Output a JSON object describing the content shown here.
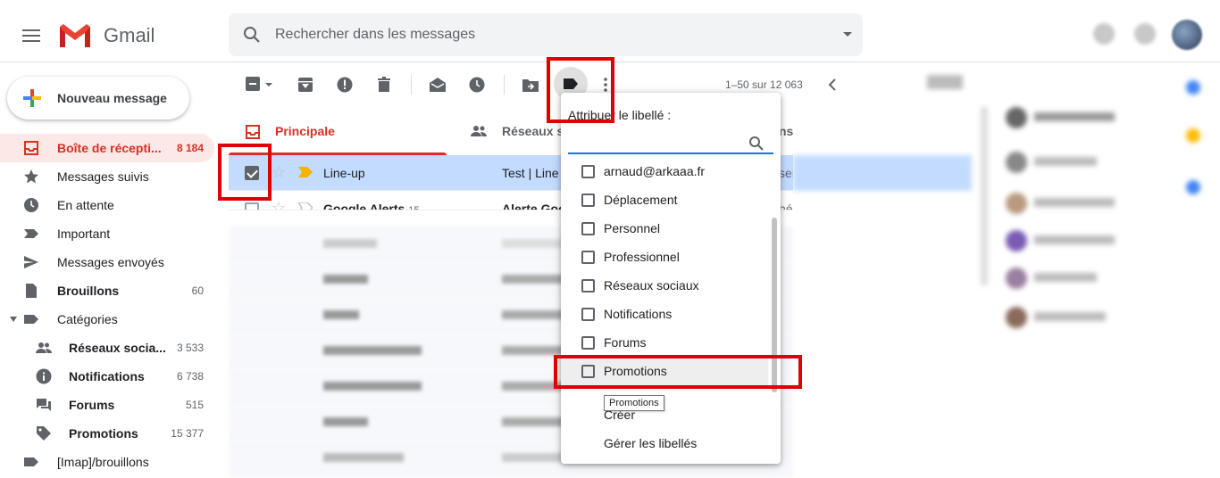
{
  "header": {
    "app_name": "Gmail",
    "search_placeholder": "Rechercher dans les messages"
  },
  "sidebar": {
    "compose_label": "Nouveau message",
    "items": [
      {
        "label": "Boîte de récepti...",
        "count": "8 184",
        "icon": "inbox-icon"
      },
      {
        "label": "Messages suivis",
        "count": "",
        "icon": "star-icon"
      },
      {
        "label": "En attente",
        "count": "",
        "icon": "clock-icon"
      },
      {
        "label": "Important",
        "count": "",
        "icon": "important-icon"
      },
      {
        "label": "Messages envoyés",
        "count": "",
        "icon": "send-icon"
      },
      {
        "label": "Brouillons",
        "count": "60",
        "icon": "draft-icon"
      },
      {
        "label": "Catégories",
        "count": "",
        "icon": "label-icon"
      },
      {
        "label": "Réseaux socia...",
        "count": "3 533",
        "icon": "people-icon"
      },
      {
        "label": "Notifications",
        "count": "6 738",
        "icon": "info-icon"
      },
      {
        "label": "Forums",
        "count": "515",
        "icon": "forum-icon"
      },
      {
        "label": "Promotions",
        "count": "15 377",
        "icon": "tag-icon"
      },
      {
        "label": "[Imap]/brouillons",
        "count": "",
        "icon": "label-icon"
      }
    ]
  },
  "toolbar": {
    "pager": "1–50 sur 12 063"
  },
  "tabs": {
    "primary": "Principale",
    "social": "Réseaux s",
    "partial": "ns"
  },
  "rows": [
    {
      "from": "Line-up",
      "count": "",
      "subject": "Test | Line",
      "snippet": "ser",
      "selected": true
    },
    {
      "from": "Google Alerts",
      "count": "15",
      "subject": "Alerte Goo",
      "snippet": "hé",
      "selected": false
    }
  ],
  "label_menu": {
    "title": "Attribuer le libellé :",
    "labels": [
      "arnaud@arkaaa.fr",
      "Déplacement",
      "Personnel",
      "Professionnel",
      "Réseaux sociaux",
      "Notifications",
      "Forums",
      "Promotions"
    ],
    "create": "Créer",
    "manage": "Gérer les libellés",
    "tooltip": "Promotions"
  },
  "colors": {
    "accent_red": "#d93025",
    "highlight_box": "#e00000",
    "selected_row": "#c2dbff",
    "focus_blue": "#1a73e8"
  }
}
